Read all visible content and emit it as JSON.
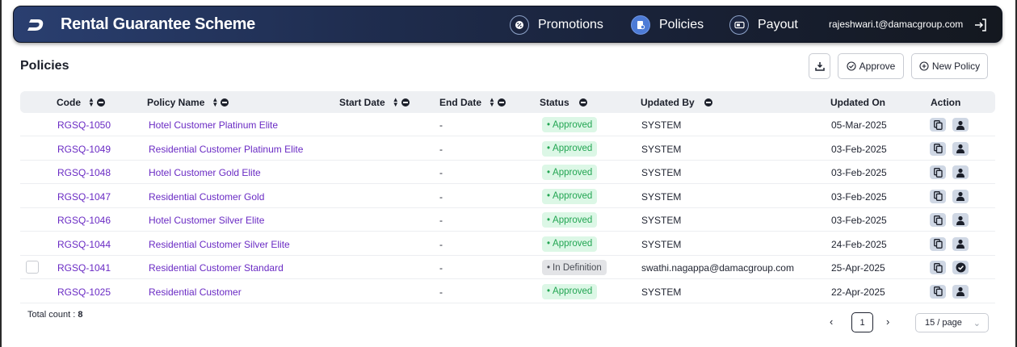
{
  "header": {
    "title": "Rental Guarantee Scheme",
    "nav": [
      {
        "label": "Promotions",
        "icon": "promotion-icon",
        "active": false
      },
      {
        "label": "Policies",
        "icon": "policy-icon",
        "active": true
      },
      {
        "label": "Payout",
        "icon": "payout-icon",
        "active": false
      }
    ],
    "user_email": "rajeshwari.t@damacgroup.com"
  },
  "page": {
    "title": "Policies",
    "approve_label": "Approve",
    "new_policy_label": "New Policy"
  },
  "table": {
    "columns": [
      "Code",
      "Policy Name",
      "Start Date",
      "End Date",
      "Status",
      "Updated By",
      "Updated On",
      "Action"
    ],
    "rows": [
      {
        "code": "RGSQ-1050",
        "name": "Hotel Customer Platinum Elite",
        "start": "-",
        "status": "Approved",
        "updated_by": "SYSTEM",
        "updated_on": "05-Mar-2025",
        "checkbox": false,
        "second_action": "user-icon"
      },
      {
        "code": "RGSQ-1049",
        "name": "Residential Customer Platinum Elite",
        "start": "-",
        "status": "Approved",
        "updated_by": "SYSTEM",
        "updated_on": "03-Feb-2025",
        "checkbox": false,
        "second_action": "user-icon"
      },
      {
        "code": "RGSQ-1048",
        "name": "Hotel Customer Gold Elite",
        "start": "-",
        "status": "Approved",
        "updated_by": "SYSTEM",
        "updated_on": "03-Feb-2025",
        "checkbox": false,
        "second_action": "user-icon"
      },
      {
        "code": "RGSQ-1047",
        "name": "Residential Customer Gold",
        "start": "-",
        "status": "Approved",
        "updated_by": "SYSTEM",
        "updated_on": "03-Feb-2025",
        "checkbox": false,
        "second_action": "user-icon"
      },
      {
        "code": "RGSQ-1046",
        "name": "Hotel Customer Silver Elite",
        "start": "-",
        "status": "Approved",
        "updated_by": "SYSTEM",
        "updated_on": "03-Feb-2025",
        "checkbox": false,
        "second_action": "user-icon"
      },
      {
        "code": "RGSQ-1044",
        "name": "Residential Customer Silver Elite",
        "start": "-",
        "status": "Approved",
        "updated_by": "SYSTEM",
        "updated_on": "24-Feb-2025",
        "checkbox": false,
        "second_action": "user-icon"
      },
      {
        "code": "RGSQ-1041",
        "name": "Residential Customer Standard",
        "start": "-",
        "status": "In Definition",
        "updated_by": "swathi.nagappa@damacgroup.com",
        "updated_on": "25-Apr-2025",
        "checkbox": true,
        "second_action": "check-circle-icon"
      },
      {
        "code": "RGSQ-1025",
        "name": "Residential Customer",
        "start": "-",
        "status": "Approved",
        "updated_by": "SYSTEM",
        "updated_on": "22-Apr-2025",
        "checkbox": false,
        "second_action": "user-icon"
      }
    ]
  },
  "footer": {
    "total_label": "Total count :",
    "total_value": "8",
    "current_page": "1",
    "page_size": "15 / page"
  },
  "colors": {
    "link": "#6a2bc4",
    "approved_bg": "#dcf7e6",
    "approved_text": "#22a552",
    "active_nav": "#4d7bd6"
  }
}
